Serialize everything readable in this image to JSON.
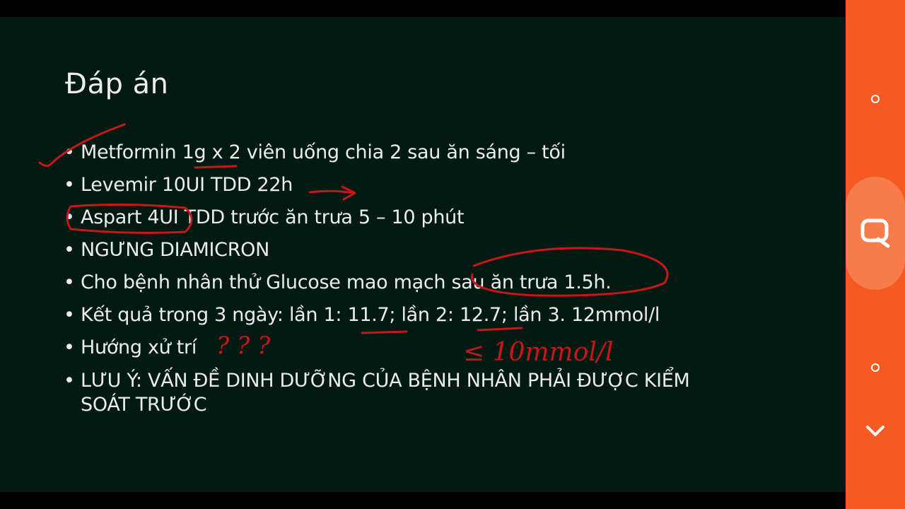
{
  "slide": {
    "title": "Đáp án",
    "bullet_char": "•",
    "bullets": [
      "Metformin 1g x 2 viên uống chia 2 sau ăn sáng – tối",
      "Levemir 10UI TDD 22h",
      "Aspart 4UI TDD trước ăn trưa 5 – 10 phút",
      "NGƯNG DIAMICRON",
      "Cho bệnh nhân thử Glucose mao mạch sau ăn trưa 1.5h.",
      "Kết quả trong 3 ngày: lần 1: 11.7; lần 2: 12.7; lần 3. 12mmol/l",
      "Hướng xử trí",
      "LƯU Ý: VẤN ĐỀ DINH DƯỠNG CỦA BỆNH NHÂN PHẢI ĐƯỢC KIỂM SOÁT TRƯỚC"
    ],
    "annotations": {
      "question_marks": "? ? ?",
      "target_note": "≤ 10mmol/l",
      "ink_color": "#c8171b"
    }
  },
  "side_panel": {
    "background": "#f55a23",
    "buttons": [
      {
        "name": "circle-icon"
      },
      {
        "name": "screenshot-search-icon"
      },
      {
        "name": "circle-icon"
      },
      {
        "name": "chevron-down-icon"
      }
    ]
  }
}
